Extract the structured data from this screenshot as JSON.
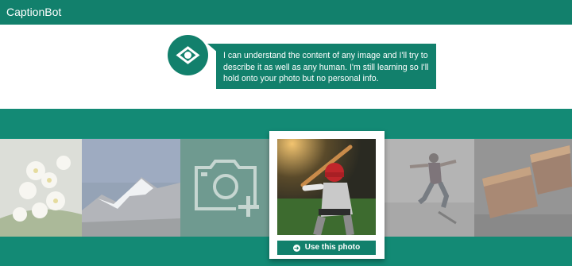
{
  "app": {
    "title": "CaptionBot"
  },
  "hero": {
    "description": "I can understand the content of any image and I'll try to describe it as well as any human. I'm still learning so I'll hold onto your photo but no personal info."
  },
  "actions": {
    "use_photo_label": "Use this photo"
  },
  "colors": {
    "brand": "#12806c",
    "band": "#138a75"
  },
  "icons": {
    "hero": "eye-icon",
    "upload": "camera-plus-icon",
    "use_photo": "arrow-circle-right-icon"
  }
}
